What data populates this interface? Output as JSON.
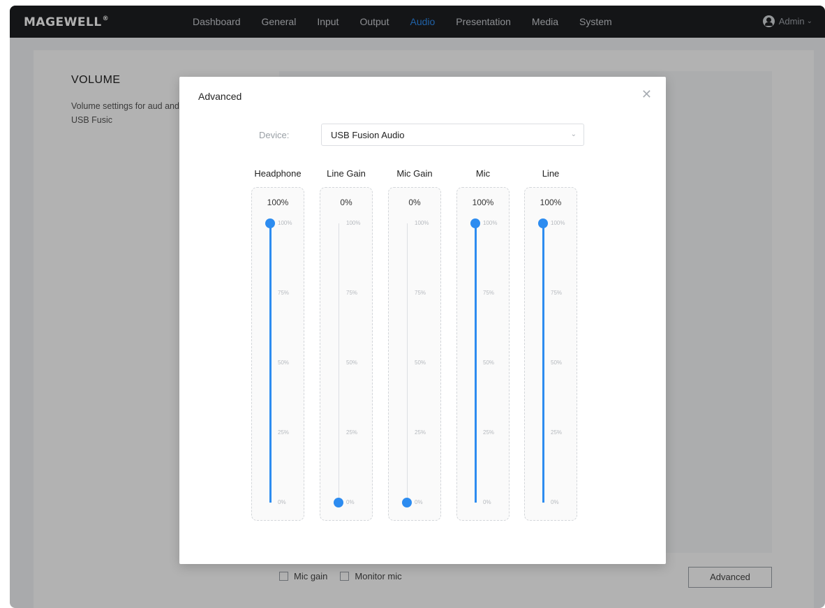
{
  "nav": {
    "logo": "MAGEWELL",
    "items": [
      {
        "label": "Dashboard",
        "active": false
      },
      {
        "label": "General",
        "active": false
      },
      {
        "label": "Input",
        "active": false
      },
      {
        "label": "Output",
        "active": false
      },
      {
        "label": "Audio",
        "active": true
      },
      {
        "label": "Presentation",
        "active": false
      },
      {
        "label": "Media",
        "active": false
      },
      {
        "label": "System",
        "active": false
      }
    ],
    "user": "Admin",
    "accent_color": "#2d8cf0"
  },
  "page": {
    "section_title": "VOLUME",
    "section_desc": "Volume settings for aud and inputs of USB Fusic",
    "checkboxes": [
      {
        "label": "Mic gain",
        "checked": false
      },
      {
        "label": "Monitor mic",
        "checked": false
      }
    ],
    "advanced_button": "Advanced"
  },
  "modal": {
    "title": "Advanced",
    "device_label": "Device:",
    "device_value": "USB Fusion Audio",
    "sliders": [
      {
        "label": "Headphone",
        "value_text": "100%",
        "value": 100
      },
      {
        "label": "Line Gain",
        "value_text": "0%",
        "value": 0
      },
      {
        "label": "Mic Gain",
        "value_text": "0%",
        "value": 0
      },
      {
        "label": "Mic",
        "value_text": "100%",
        "value": 100
      },
      {
        "label": "Line",
        "value_text": "100%",
        "value": 100
      }
    ],
    "ticks": [
      "100%",
      "75%",
      "50%",
      "25%",
      "0%"
    ]
  }
}
